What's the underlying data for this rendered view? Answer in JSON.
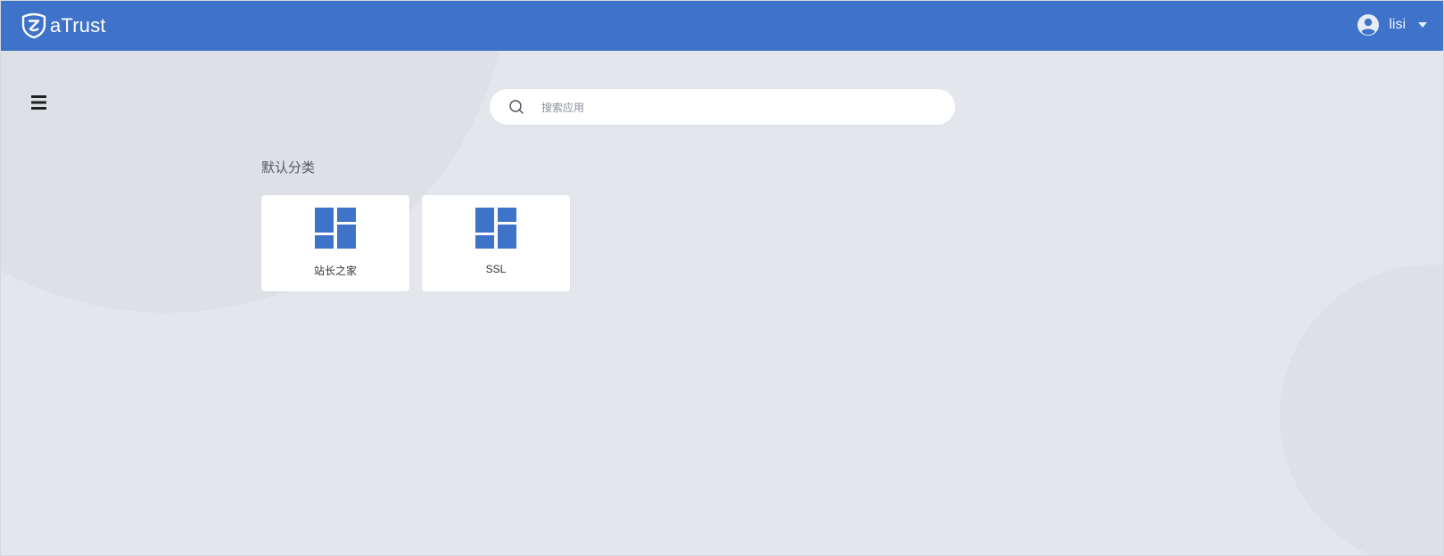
{
  "header": {
    "logo_text": "aTrust",
    "user_name": "lisi",
    "background": "#3e73c9"
  },
  "icons": {
    "logo": "atrust-logo-icon",
    "avatar": "user-avatar-icon",
    "caret": "chevron-down-icon",
    "menu": "hamburger-menu-icon",
    "search": "search-icon",
    "app": "app-grid-icon"
  },
  "search": {
    "placeholder": "搜索应用",
    "value": ""
  },
  "category": {
    "title": "默认分类",
    "apps": [
      {
        "label": "站长之家"
      },
      {
        "label": "SSL"
      }
    ]
  },
  "colors": {
    "accent": "#3e73c9",
    "page_background": "#e3e7eb"
  }
}
